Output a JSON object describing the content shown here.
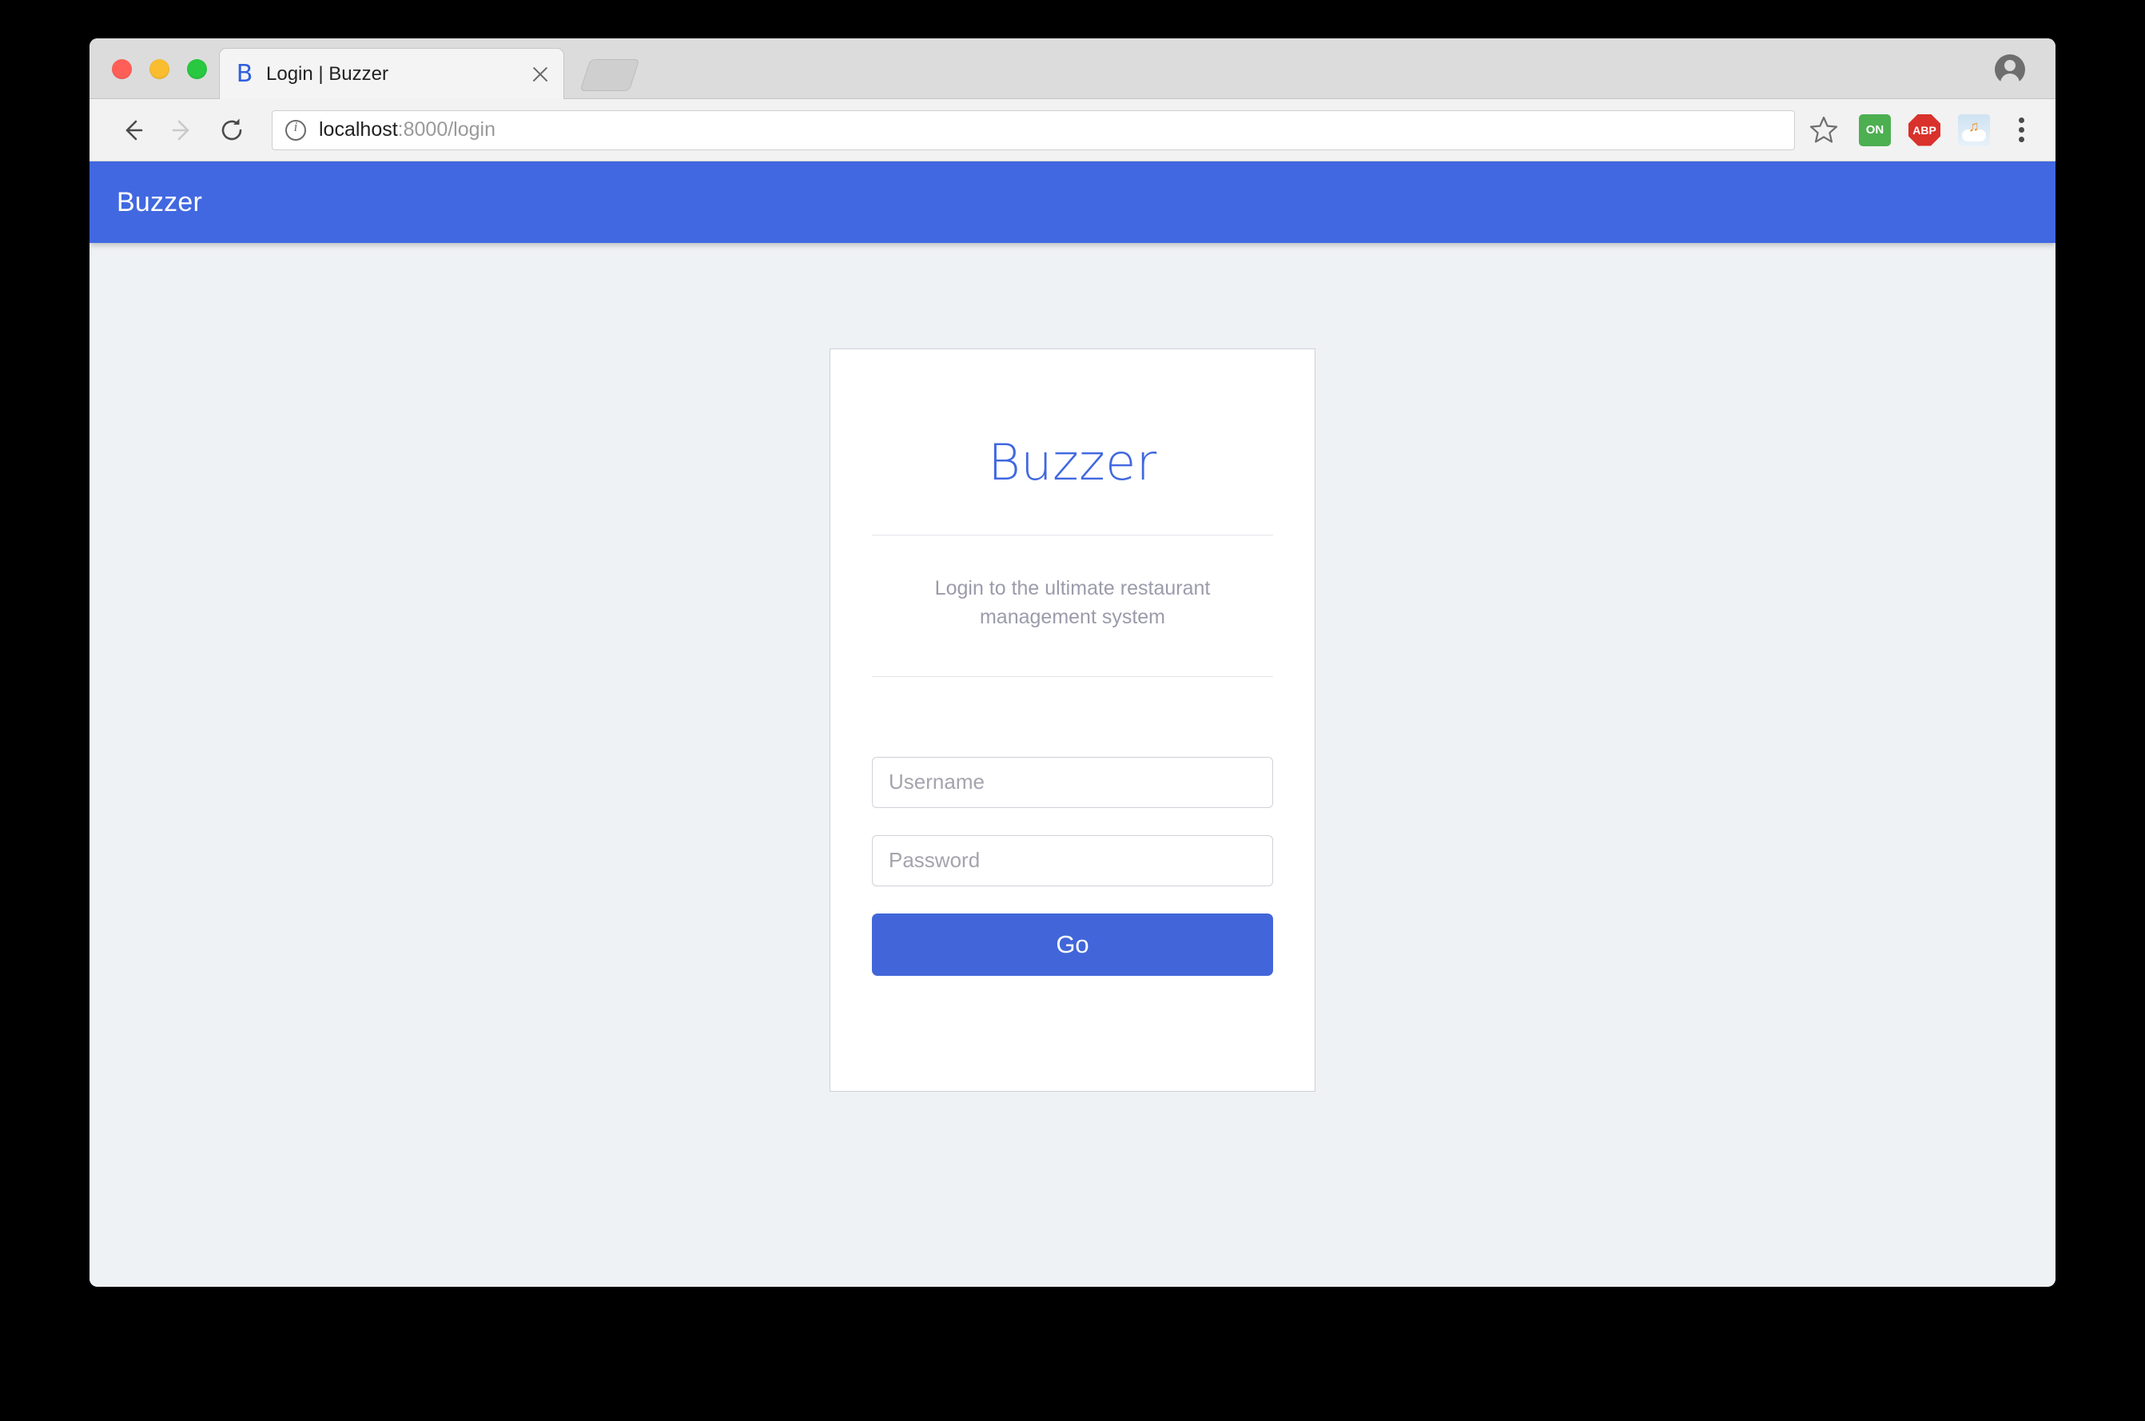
{
  "window": {
    "traffic_lights": [
      "close",
      "minimize",
      "maximize"
    ]
  },
  "browser": {
    "tab": {
      "favicon_letter": "B",
      "title": "Login | Buzzer",
      "close_icon": "close-icon"
    },
    "new_tab_label": "",
    "profile_icon": "account-icon",
    "toolbar": {
      "back_icon": "back-arrow-icon",
      "forward_icon": "forward-arrow-icon",
      "reload_icon": "reload-icon",
      "info_icon": "page-info-icon",
      "url_host": "localhost",
      "url_rest": ":8000/login",
      "url_full": "localhost:8000/login",
      "star_icon": "bookmark-star-icon",
      "extensions": [
        {
          "name": "on-toggle-extension",
          "label": "ON"
        },
        {
          "name": "adblock-plus-extension",
          "label": "ABP"
        },
        {
          "name": "cloud-music-extension",
          "label": ""
        }
      ],
      "menu_icon": "three-dot-menu-icon"
    }
  },
  "page": {
    "navbar": {
      "brand": "Buzzer"
    },
    "login_card": {
      "title": "Buzzer",
      "subtitle": "Login to the ultimate restaurant management system",
      "username": {
        "value": "",
        "placeholder": "Username"
      },
      "password": {
        "value": "",
        "placeholder": "Password"
      },
      "submit_label": "Go"
    }
  },
  "colors": {
    "brand_blue": "#4168e0",
    "button_blue": "#4266d9",
    "page_background": "#eff2f5",
    "card_background": "#ffffff",
    "muted_text": "#9b9bab"
  }
}
